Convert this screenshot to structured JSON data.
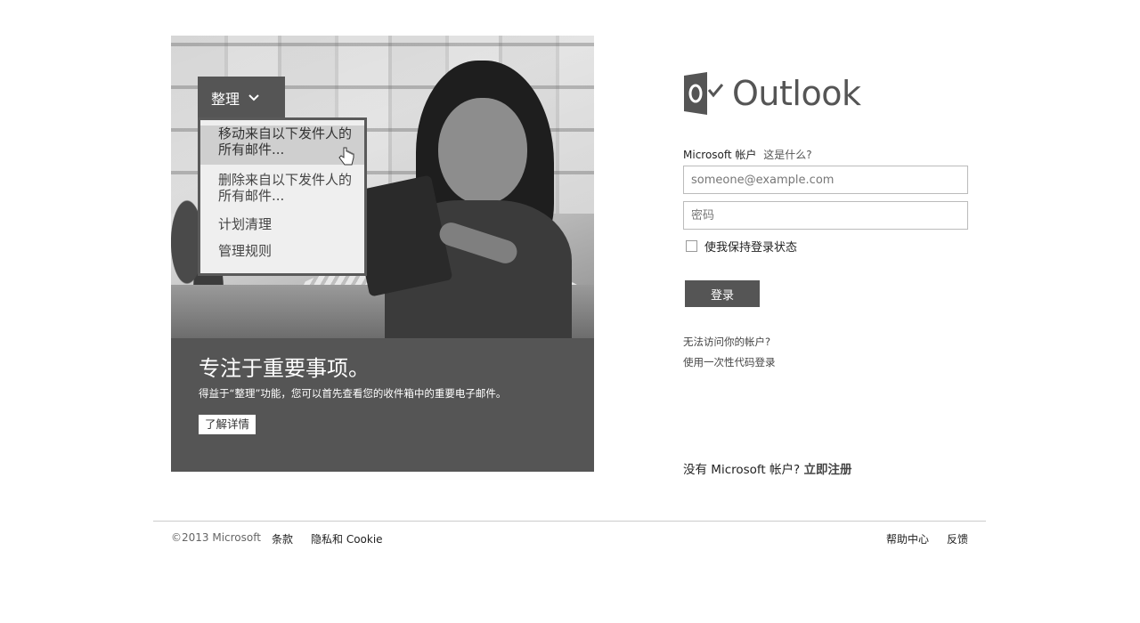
{
  "hero": {
    "menu": {
      "header_label": "整理",
      "items": [
        "移动来自以下发件人的所有邮件...",
        "删除来自以下发件人的所有邮件...",
        "计划清理",
        "管理规则"
      ]
    },
    "promo": {
      "title": "专注于重要事项。",
      "description": "得益于“整理”功能，您可以首先查看您的收件箱中的重要电子邮件。",
      "learn_more": "了解详情"
    }
  },
  "signin": {
    "logo_text": "Outlook",
    "account_label": "Microsoft 帐户",
    "whats_this": "这是什么?",
    "email_placeholder": "someone@example.com",
    "password_placeholder": "密码",
    "keep_signed_in": "使我保持登录状态",
    "keep_signed_in_checked": false,
    "sign_in_button": "登录",
    "cant_access": "无法访问你的帐户?",
    "single_use_code": "使用一次性代码登录",
    "no_account_text": "没有 Microsoft 帐户?",
    "sign_up_link": "立即注册"
  },
  "footer": {
    "copyright": "©2013 Microsoft",
    "terms": "条款",
    "privacy": "隐私和 Cookie",
    "help": "帮助中心",
    "feedback": "反馈"
  },
  "colors": {
    "promo_bg": "#555555",
    "button_bg": "#555555",
    "logo": "#555555",
    "border": "#bbbbbb"
  }
}
